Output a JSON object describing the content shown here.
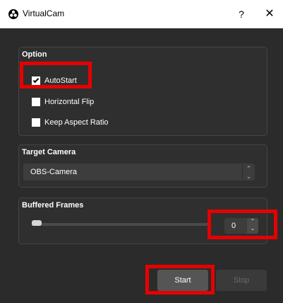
{
  "window": {
    "title": "VirtualCam",
    "help_label": "?",
    "close_label": "✕",
    "app_icon": "obs-logo-icon"
  },
  "option_group": {
    "title": "Option",
    "checkboxes": [
      {
        "label": "AutoStart",
        "checked": true
      },
      {
        "label": "Horizontal Flip",
        "checked": false
      },
      {
        "label": "Keep Aspect Ratio",
        "checked": false
      }
    ]
  },
  "target_camera": {
    "title": "Target Camera",
    "selected": "OBS-Camera"
  },
  "buffered_frames": {
    "title": "Buffered Frames",
    "value": "0",
    "slider_fraction": 0
  },
  "buttons": {
    "start": "Start",
    "stop": "Stop"
  },
  "colors": {
    "background": "#2b2b2b",
    "annotation": "#e60000"
  }
}
